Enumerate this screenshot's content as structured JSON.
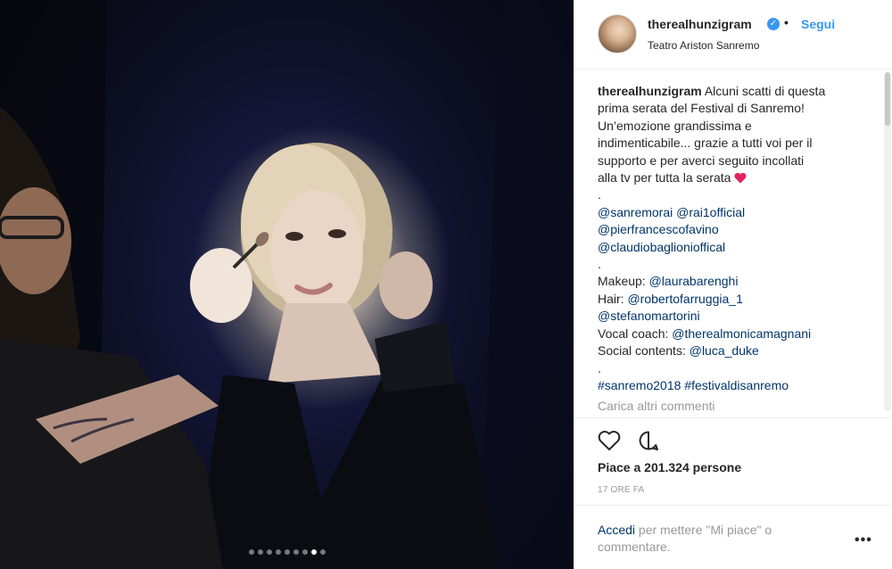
{
  "photo": {
    "slide_count": 9,
    "active_slide": 8
  },
  "post": {
    "username": "therealhunzigram",
    "verified_icon": "verified-badge-icon",
    "separator": "•",
    "follow_label": "Segui",
    "location": "Teatro Ariston Sanremo"
  },
  "caption": {
    "username": "therealhunzigram",
    "lines": [
      "Alcuni scatti di questa",
      "prima serata del Festival di Sanremo!",
      "Un’emozione grandissima e",
      "indimenticabile... grazie a tutti voi per il",
      "supporto e per averci seguito incollati",
      "alla tv per tutta la serata",
      ".",
      "@sanremorai @rai1official",
      "@pierfrancescofavino",
      "@claudiobaglionioffical",
      ".",
      "Makeup: ",
      "@laurabarenghi",
      "Hair: ",
      "@robertofarruggia_1",
      "@stefanomartorini",
      "Vocal coach: ",
      "@therealmonicamagnani",
      "Social contents: ",
      "@luca_duke",
      ".",
      "#sanremo2018 #festivaldisanremo"
    ],
    "heart_icon": "red-heart-emoji-icon",
    "load_more": "Carica altri commenti"
  },
  "actions": {
    "like_icon": "heart-outline-icon",
    "comment_icon": "comment-bubble-icon",
    "likes": "Piace a 201.324 persone",
    "time": "17 ORE FA"
  },
  "footer": {
    "login_link": "Accedi",
    "login_text": " per mettere \"Mi piace\" o commentare.",
    "more_icon": "more-options-icon",
    "more_label": "•••"
  },
  "colors": {
    "link_blue": "#3897f0",
    "mention_blue": "#003569",
    "muted": "#999999",
    "text": "#262626"
  }
}
